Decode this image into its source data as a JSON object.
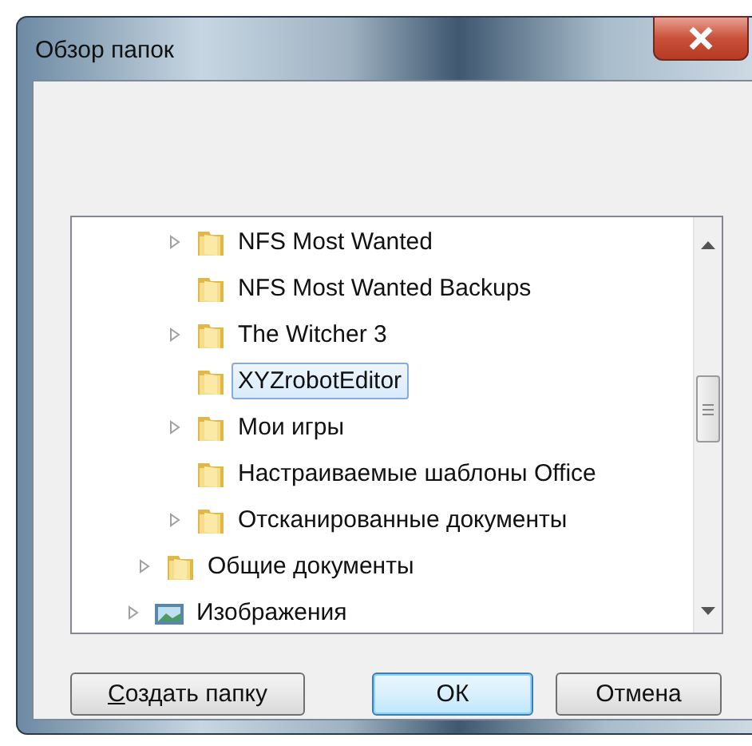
{
  "window": {
    "title": "Обзор папок"
  },
  "tree": {
    "items": [
      {
        "children": [
          {
            "children": [
              {
                "label": "NFS Most Wanted",
                "kind": "folder",
                "expandable": true,
                "selected": false
              },
              {
                "label": "NFS Most Wanted Backups",
                "kind": "folder",
                "expandable": false,
                "selected": false
              },
              {
                "label": "The Witcher 3",
                "kind": "folder",
                "expandable": true,
                "selected": false
              },
              {
                "label": "XYZrobotEditor",
                "kind": "folder",
                "expandable": false,
                "selected": true
              },
              {
                "label": "Мои игры",
                "kind": "folder",
                "expandable": true,
                "selected": false
              },
              {
                "label": "Настраиваемые шаблоны Office",
                "kind": "folder",
                "expandable": false,
                "selected": false
              },
              {
                "label": "Отсканированные документы",
                "kind": "folder",
                "expandable": true,
                "selected": false
              }
            ]
          },
          {
            "label": "Общие документы",
            "kind": "folder",
            "expandable": true,
            "selected": false
          }
        ]
      },
      {
        "label": "Изображения",
        "kind": "pictures",
        "expandable": true,
        "selected": false
      }
    ]
  },
  "buttons": [
    {
      "label": "Создать папку",
      "mnemonic": true,
      "default": false
    },
    {
      "label": "ОК",
      "default": true
    },
    {
      "label": "Отмена",
      "default": false
    }
  ]
}
